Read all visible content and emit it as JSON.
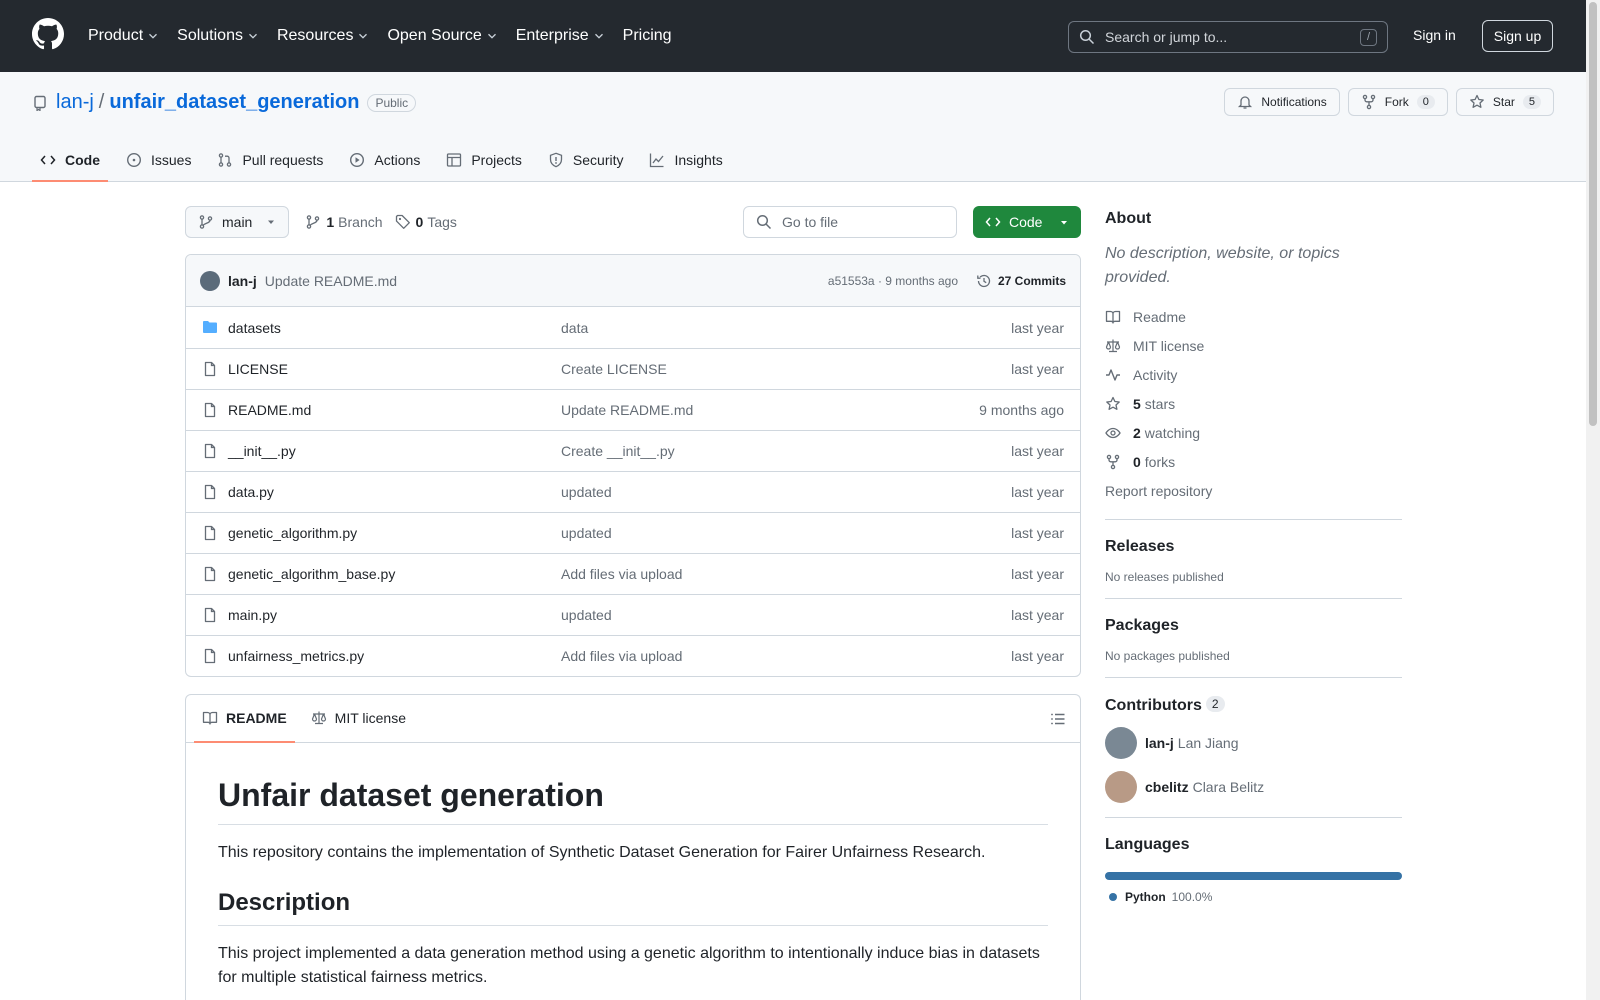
{
  "header": {
    "nav": [
      "Product",
      "Solutions",
      "Resources",
      "Open Source",
      "Enterprise",
      "Pricing"
    ],
    "search_placeholder": "Search or jump to...",
    "search_shortcut": "/",
    "sign_in": "Sign in",
    "sign_up": "Sign up"
  },
  "repo": {
    "owner": "lan-j",
    "separator": "/",
    "name": "unfair_dataset_generation",
    "visibility": "Public",
    "notifications_label": "Notifications",
    "fork_label": "Fork",
    "fork_count": "0",
    "star_label": "Star",
    "star_count": "5",
    "tabs": [
      "Code",
      "Issues",
      "Pull requests",
      "Actions",
      "Projects",
      "Security",
      "Insights"
    ]
  },
  "toolbar": {
    "branch": "main",
    "branch_count": "1",
    "branch_label": "Branch",
    "tag_count": "0",
    "tag_label": "Tags",
    "go_to_file": "Go to file",
    "code_label": "Code"
  },
  "commit": {
    "user": "lan-j",
    "message": "Update README.md",
    "sha_time": "a51553a · 9 months ago",
    "commits": "27 Commits"
  },
  "files": [
    {
      "name": "datasets",
      "message": "data",
      "date": "last year",
      "type": "dir"
    },
    {
      "name": "LICENSE",
      "message": "Create LICENSE",
      "date": "last year",
      "type": "file"
    },
    {
      "name": "README.md",
      "message": "Update README.md",
      "date": "9 months ago",
      "type": "file"
    },
    {
      "name": "__init__.py",
      "message": "Create __init__.py",
      "date": "last year",
      "type": "file"
    },
    {
      "name": "data.py",
      "message": "updated",
      "date": "last year",
      "type": "file"
    },
    {
      "name": "genetic_algorithm.py",
      "message": "updated",
      "date": "last year",
      "type": "file"
    },
    {
      "name": "genetic_algorithm_base.py",
      "message": "Add files via upload",
      "date": "last year",
      "type": "file"
    },
    {
      "name": "main.py",
      "message": "updated",
      "date": "last year",
      "type": "file"
    },
    {
      "name": "unfairness_metrics.py",
      "message": "Add files via upload",
      "date": "last year",
      "type": "file"
    }
  ],
  "readme": {
    "tab_readme": "README",
    "tab_license": "MIT license",
    "h1": "Unfair dataset generation",
    "p1": "This repository contains the implementation of Synthetic Dataset Generation for Fairer Unfairness Research.",
    "h2": "Description",
    "p2": "This project implemented a data generation method using a genetic algorithm to intentionally induce bias in datasets for multiple statistical fairness metrics."
  },
  "sidebar": {
    "about_title": "About",
    "about_desc": "No description, website, or topics provided.",
    "readme": "Readme",
    "license": "MIT license",
    "activity": "Activity",
    "stars_count": "5",
    "stars_label": "stars",
    "watching_count": "2",
    "watching_label": "watching",
    "forks_count": "0",
    "forks_label": "forks",
    "report": "Report repository",
    "releases_title": "Releases",
    "releases_none": "No releases published",
    "packages_title": "Packages",
    "packages_none": "No packages published",
    "contributors_title": "Contributors",
    "contributors_count": "2",
    "contributors": [
      {
        "login": "lan-j",
        "name": "Lan Jiang"
      },
      {
        "login": "cbelitz",
        "name": "Clara Belitz"
      }
    ],
    "languages_title": "Languages",
    "language": "Python",
    "language_pct": "100.0%",
    "language_share": 100,
    "language_color": "#3572a5"
  }
}
